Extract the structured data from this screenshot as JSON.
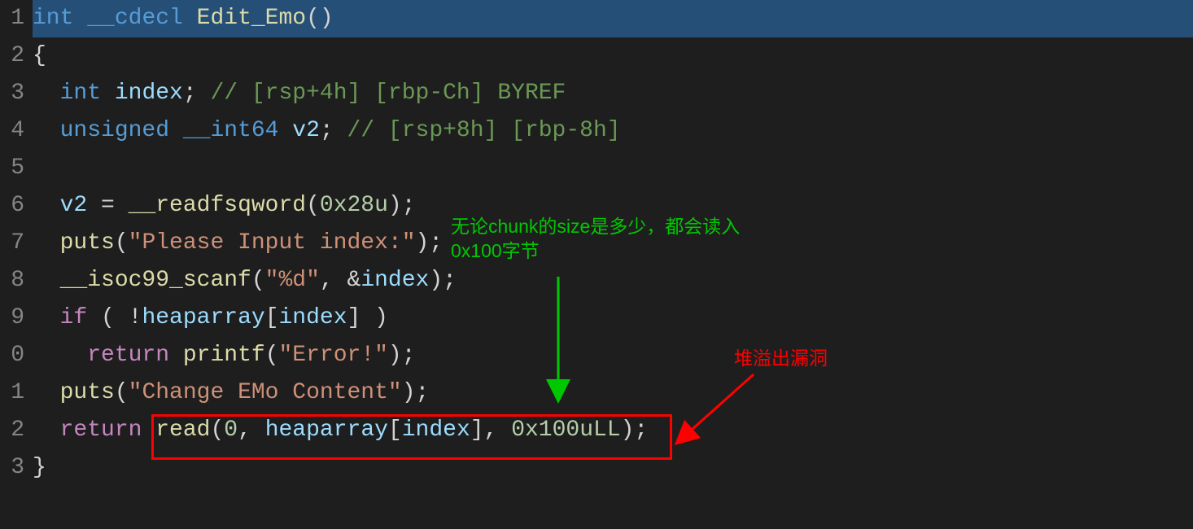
{
  "gutter": {
    "l1": "1",
    "l2": "2",
    "l3": "3",
    "l4": "4",
    "l5": "5",
    "l6": "6",
    "l7": "7",
    "l8": "8",
    "l9": "9",
    "l10": "0",
    "l11": "1",
    "l12": "2",
    "l13": "3"
  },
  "code": {
    "l1": {
      "t_int": "int",
      "sp1": " ",
      "t_cdecl": "__cdecl",
      "sp2": " ",
      "fn": "Edit_Emo",
      "paren": "()"
    },
    "l2": {
      "brace": "{"
    },
    "l3": {
      "indent": "  ",
      "t_int": "int",
      "sp": " ",
      "var": "index",
      "semi": ";",
      "comment": " // [rsp+4h] [rbp-Ch] BYREF"
    },
    "l4": {
      "indent": "  ",
      "t_unsigned": "unsigned",
      "sp": " ",
      "t_int64": "__int64",
      "sp2": " ",
      "var": "v2",
      "semi": ";",
      "comment": " // [rsp+8h] [rbp-8h]"
    },
    "l5": {
      "blank": ""
    },
    "l6": {
      "indent": "  ",
      "var": "v2",
      "eq": " = ",
      "fn": "__readfsqword",
      "open": "(",
      "arg": "0x28u",
      "close": ");"
    },
    "l7": {
      "indent": "  ",
      "fn": "puts",
      "open": "(",
      "str": "\"Please Input index:\"",
      "close": ");"
    },
    "l8": {
      "indent": "  ",
      "fn": "__isoc99_scanf",
      "open": "(",
      "str": "\"%d\"",
      "comma": ", ",
      "amp": "&",
      "var": "index",
      "close": ");"
    },
    "l9": {
      "indent": "  ",
      "kw_if": "if",
      "sp": " ",
      "open": "( !",
      "arr": "heaparray",
      "br_open": "[",
      "var": "index",
      "br_close": "]",
      "close": " )"
    },
    "l10": {
      "indent": "    ",
      "kw_return": "return",
      "sp": " ",
      "fn": "printf",
      "open": "(",
      "str": "\"Error!\"",
      "close": ");"
    },
    "l11": {
      "indent": "  ",
      "fn": "puts",
      "open": "(",
      "str": "\"Change EMo Content\"",
      "close": ");"
    },
    "l12": {
      "indent": "  ",
      "kw_return": "return",
      "sp": " ",
      "fn": "read",
      "open": "(",
      "arg0": "0",
      "c1": ", ",
      "arr": "heaparray",
      "br_open": "[",
      "var": "index",
      "br_close": "]",
      "c2": ", ",
      "argn": "0x100uLL",
      "close": ");"
    },
    "l13": {
      "brace": "}"
    }
  },
  "annotations": {
    "green": "无论chunk的size是多少，都会读入\n0x100字节",
    "red": "堆溢出漏洞"
  },
  "colors": {
    "highlight_border": "#ff0000",
    "arrow_green": "#00c800",
    "arrow_red": "#ff0000"
  }
}
